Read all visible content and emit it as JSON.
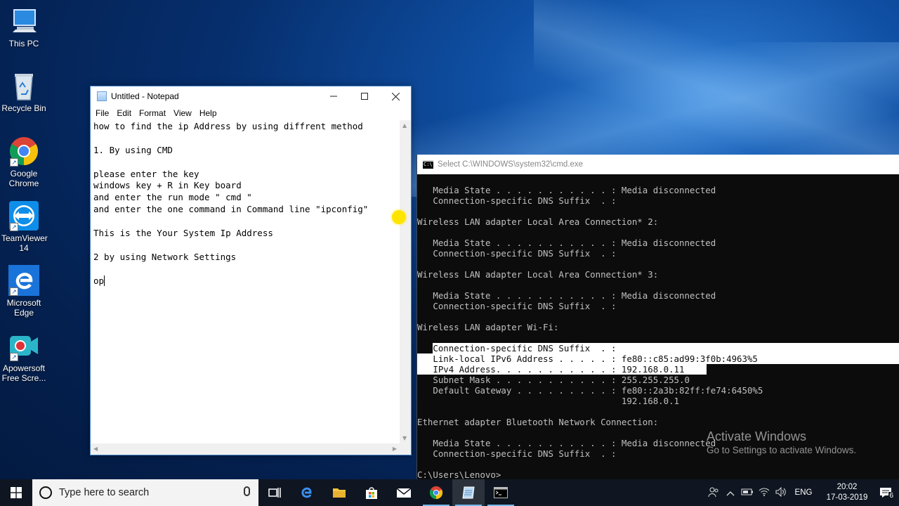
{
  "desktop": {
    "icons": [
      {
        "label": "This PC",
        "icon": "computer-icon"
      },
      {
        "label": "Recycle Bin",
        "icon": "recycle-bin-icon"
      },
      {
        "label": "Google Chrome",
        "icon": "chrome-icon"
      },
      {
        "label": "TeamViewer 14",
        "icon": "teamviewer-icon"
      },
      {
        "label": "Microsoft Edge",
        "icon": "edge-icon"
      },
      {
        "label": "Apowersoft Free Scre...",
        "icon": "apowersoft-icon"
      }
    ]
  },
  "notepad": {
    "title": "Untitled - Notepad",
    "menu": [
      "File",
      "Edit",
      "Format",
      "View",
      "Help"
    ],
    "lines": [
      "how to find the ip Address by using diffrent method",
      "",
      "1. By using CMD",
      "",
      "please enter the key",
      "windows key + R in Key board",
      "and enter the run mode \" cmd \"",
      "and enter the one command in Command line \"ipconfig\"",
      "",
      "This is the Your System Ip Address",
      "",
      "2 by using Network Settings",
      "",
      "op"
    ]
  },
  "cmd": {
    "title": "Select C:\\WINDOWS\\system32\\cmd.exe",
    "lines": [
      "   Media State . . . . . . . . . . . : Media disconnected",
      "   Connection-specific DNS Suffix  . :",
      "",
      "Wireless LAN adapter Local Area Connection* 2:",
      "",
      "   Media State . . . . . . . . . . . : Media disconnected",
      "   Connection-specific DNS Suffix  . :",
      "",
      "Wireless LAN adapter Local Area Connection* 3:",
      "",
      "   Media State . . . . . . . . . . . : Media disconnected",
      "   Connection-specific DNS Suffix  . :",
      "",
      "Wireless LAN adapter Wi-Fi:",
      "",
      "   Connection-specific DNS Suffix  . :",
      "   Link-local IPv6 Address . . . . . : fe80::c85:ad99:3f0b:4963%5",
      "   IPv4 Address. . . . . . . . . . . : 192.168.0.11",
      "   Subnet Mask . . . . . . . . . . . : 255.255.255.0",
      "   Default Gateway . . . . . . . . . : fe80::2a3b:82ff:fe74:6450%5",
      "                                       192.168.0.1",
      "",
      "Ethernet adapter Bluetooth Network Connection:",
      "",
      "   Media State . . . . . . . . . . . : Media disconnected",
      "   Connection-specific DNS Suffix  . :",
      "",
      "C:\\Users\\Lenovo>"
    ]
  },
  "watermark": {
    "line1": "Activate Windows",
    "line2": "Go to Settings to activate Windows."
  },
  "taskbar": {
    "search_placeholder": "Type here to search",
    "language": "ENG",
    "time": "20:02",
    "date": "17-03-2019",
    "notification_count": "6"
  },
  "colors": {
    "accent": "#76b9ed",
    "cmd_background": "#0c0c0c",
    "cmd_text": "#c0c0c0",
    "highlight": "#ffe400"
  }
}
